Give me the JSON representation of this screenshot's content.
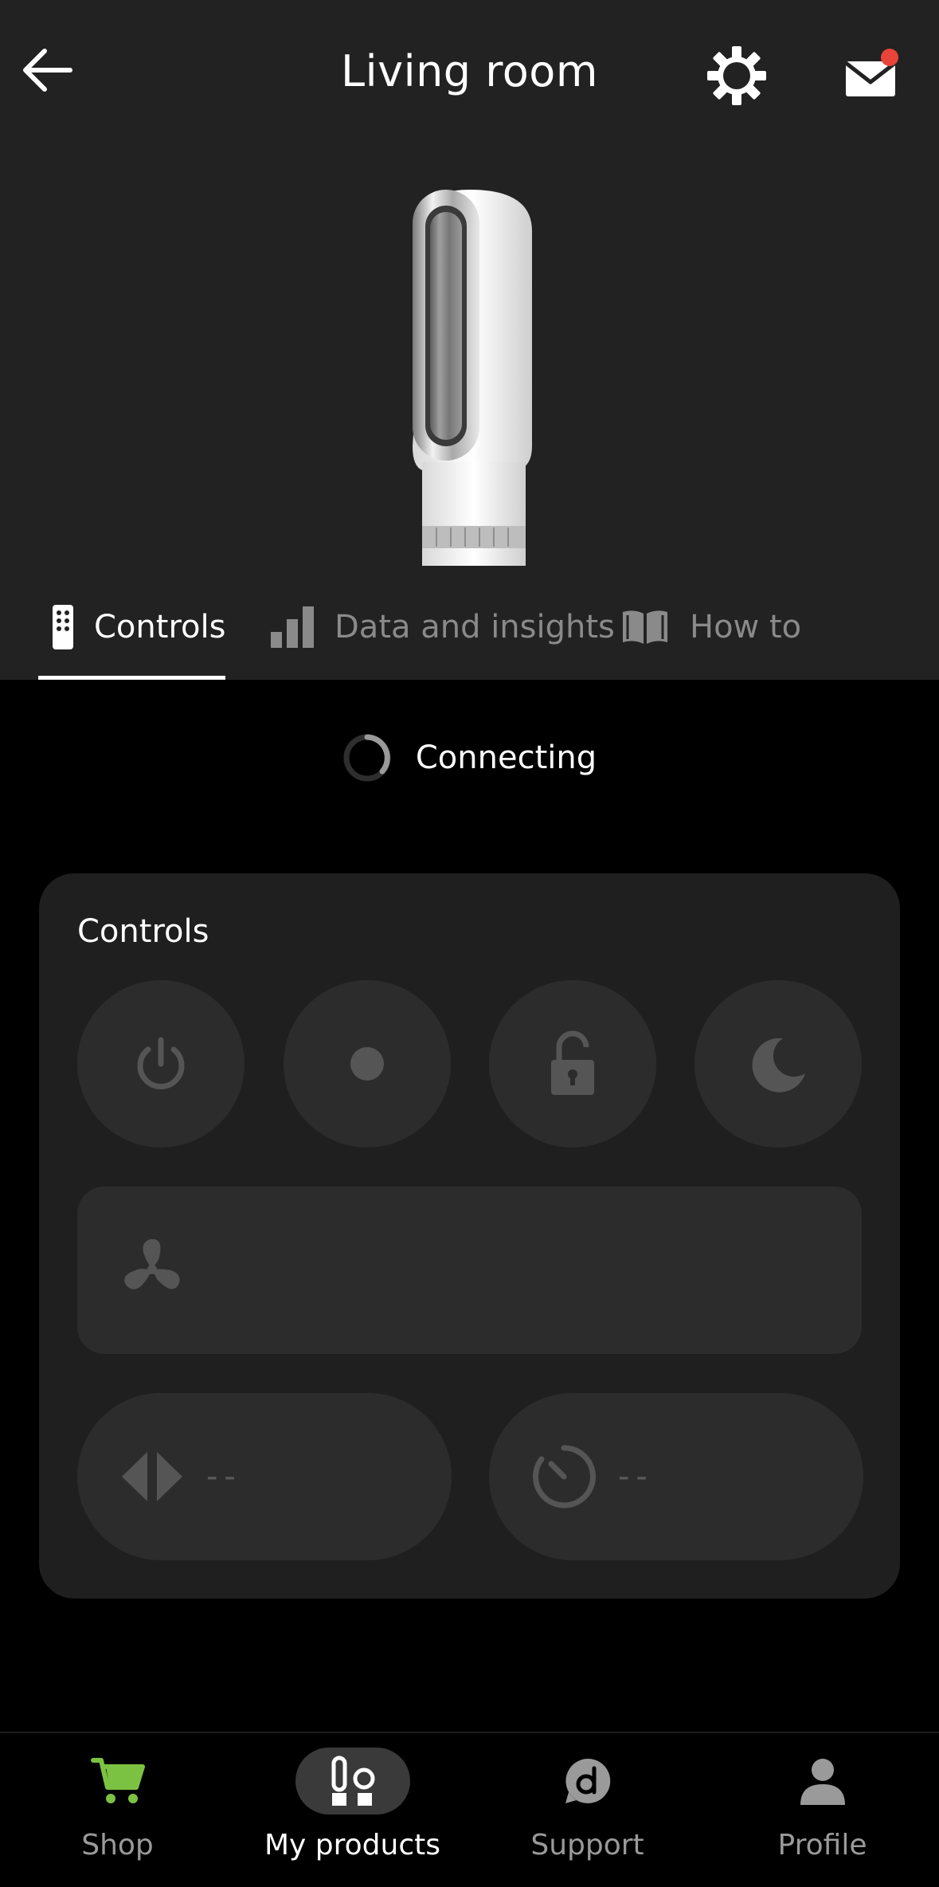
{
  "header": {
    "title": "Living room"
  },
  "tabs": [
    {
      "label": "Controls",
      "icon": "remote-icon",
      "active": true
    },
    {
      "label": "Data and insights",
      "icon": "bar-chart-icon",
      "active": false
    },
    {
      "label": "How to",
      "icon": "book-icon",
      "active": false
    }
  ],
  "status": {
    "text": "Connecting"
  },
  "controls": {
    "title": "Controls",
    "buttons": [
      "power-icon",
      "mode-dot-icon",
      "unlock-icon",
      "moon-icon"
    ],
    "fan_icon": "fan-icon",
    "oscillation_value": "--",
    "timer_value": "--"
  },
  "nav": [
    {
      "label": "Shop",
      "icon": "cart-icon",
      "active": false
    },
    {
      "label": "My products",
      "icon": "products-icon",
      "active": true
    },
    {
      "label": "Support",
      "icon": "support-icon",
      "active": false
    },
    {
      "label": "Profile",
      "icon": "person-icon",
      "active": false
    }
  ],
  "colors": {
    "hero_background": "#222222",
    "page_background": "#000000",
    "card_background": "#1f1f1f",
    "control_background": "#2c2c2c",
    "notification_dot": "#e8443a",
    "shop_accent": "#7cc242",
    "inactive_text": "#8a8a8a"
  }
}
